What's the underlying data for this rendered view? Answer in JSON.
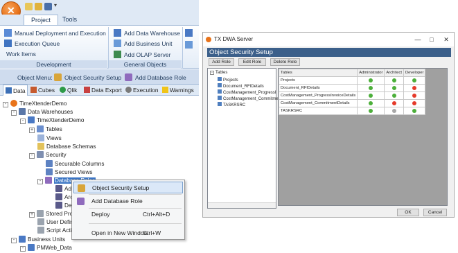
{
  "app": {
    "tabs": {
      "project": "Project",
      "tools": "Tools"
    },
    "ribbon": {
      "deployment": {
        "items": [
          "Manual Deployment and Execution",
          "Execution Queue",
          "Work Items"
        ],
        "group_label": "Development"
      },
      "general": {
        "items": [
          "Add Data Warehouse",
          "Add Business Unit",
          "Add OLAP Server"
        ],
        "group_label": "General Objects"
      }
    },
    "object_menu": {
      "label": "Object Menu:",
      "items": [
        "Object Security Setup",
        "Add Database Role"
      ]
    },
    "bottom_tabs": [
      "Data",
      "Cubes",
      "Qlik",
      "Data Export",
      "Execution",
      "Warnings"
    ],
    "tree": {
      "root": "TimeXtenderDemo",
      "data_warehouses": "Data Warehouses",
      "dw": "TimeXtenderDemo",
      "tables": "Tables",
      "views": "Views",
      "database_schemas": "Database Schemas",
      "security": "Security",
      "securable_columns": "Securable Columns",
      "secured_views": "Secured Views",
      "database_roles": "Database Roles",
      "admin": "Adm",
      "arch": "Arch",
      "dev": "Dev",
      "stored_proc": "Stored Proce",
      "user_defined": "User Define",
      "script_actions": "Script Action",
      "business_units": "Business Units",
      "pmweb_data": "PMWeb_Data"
    },
    "context_menu": [
      {
        "label": "Object Security Setup",
        "shortcut": ""
      },
      {
        "label": "Add Database Role",
        "shortcut": ""
      },
      {
        "label": "Deploy",
        "shortcut": "Ctrl+Alt+D"
      },
      {
        "label": "Open in New Window",
        "shortcut": "Ctrl+W"
      }
    ]
  },
  "dialog": {
    "title": "TX DWA Server",
    "controls": {
      "minimize": "—",
      "maximize": "□",
      "close": "✕"
    },
    "header": "Object Security Setup",
    "buttons": [
      "Add Role",
      "Edit Role",
      "Delete Role"
    ],
    "tree_root": "Tables",
    "tree_items": [
      "Projects",
      "Document_RFIDetails",
      "CostManagement_ProgressI",
      "CostManagement_Commitmer",
      "TASKRSRC"
    ],
    "grid": {
      "columns": [
        "Tables",
        "Administrator",
        "Architect",
        "Developer"
      ],
      "rows": [
        {
          "name": "Projects",
          "status": [
            "g",
            "g",
            "g"
          ]
        },
        {
          "name": "Document_RFIDetails",
          "status": [
            "g",
            "g",
            "r"
          ]
        },
        {
          "name": "CostManagement_ProgressInvoiceDetails",
          "status": [
            "g",
            "g",
            "r"
          ]
        },
        {
          "name": "CostManagement_CommitmentDetails",
          "status": [
            "g",
            "r",
            "r"
          ]
        },
        {
          "name": "TASKRSRC",
          "status": [
            "g",
            "gr",
            "g"
          ]
        }
      ]
    },
    "ok": "OK",
    "cancel": "Cancel"
  }
}
